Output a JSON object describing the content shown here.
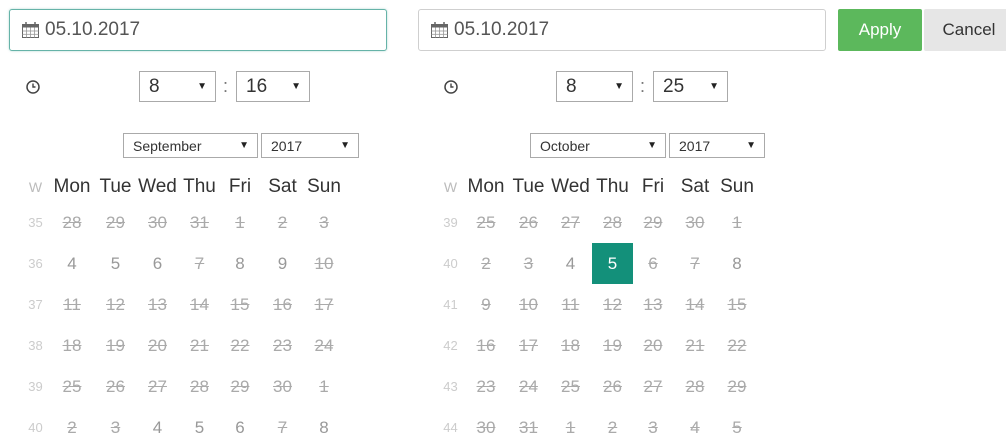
{
  "start": {
    "date": "05.10.2017",
    "hour": "8",
    "minute": "16",
    "month": "September",
    "year": "2017"
  },
  "end": {
    "date": "05.10.2017",
    "hour": "8",
    "minute": "25",
    "month": "October",
    "year": "2017"
  },
  "buttons": {
    "apply": "Apply",
    "cancel": "Cancel"
  },
  "time_separator": ":",
  "icons": {
    "date": "calendar-icon",
    "time": "clock-icon",
    "dropdown": "caret-down-icon"
  },
  "colors": {
    "apply": "#5cb85c",
    "selected_day": "#13907a",
    "active_border": "#66b3a8"
  },
  "calendar_headers": [
    "W",
    "Mon",
    "Tue",
    "Wed",
    "Thu",
    "Fri",
    "Sat",
    "Sun"
  ],
  "left_calendar": {
    "weeks": [
      {
        "week": "35",
        "days": [
          {
            "d": "28",
            "s": "dis"
          },
          {
            "d": "29",
            "s": "dis"
          },
          {
            "d": "30",
            "s": "dis"
          },
          {
            "d": "31",
            "s": "dis"
          },
          {
            "d": "1",
            "s": "dis"
          },
          {
            "d": "2",
            "s": "dis"
          },
          {
            "d": "3",
            "s": "dis"
          }
        ]
      },
      {
        "week": "36",
        "days": [
          {
            "d": "4",
            "s": "avail"
          },
          {
            "d": "5",
            "s": "avail"
          },
          {
            "d": "6",
            "s": "avail"
          },
          {
            "d": "7",
            "s": "dis"
          },
          {
            "d": "8",
            "s": "avail"
          },
          {
            "d": "9",
            "s": "avail"
          },
          {
            "d": "10",
            "s": "dis"
          }
        ]
      },
      {
        "week": "37",
        "days": [
          {
            "d": "11",
            "s": "dis"
          },
          {
            "d": "12",
            "s": "dis"
          },
          {
            "d": "13",
            "s": "dis"
          },
          {
            "d": "14",
            "s": "dis"
          },
          {
            "d": "15",
            "s": "dis"
          },
          {
            "d": "16",
            "s": "dis"
          },
          {
            "d": "17",
            "s": "dis"
          }
        ]
      },
      {
        "week": "38",
        "days": [
          {
            "d": "18",
            "s": "dis"
          },
          {
            "d": "19",
            "s": "dis"
          },
          {
            "d": "20",
            "s": "dis"
          },
          {
            "d": "21",
            "s": "dis"
          },
          {
            "d": "22",
            "s": "dis"
          },
          {
            "d": "23",
            "s": "dis"
          },
          {
            "d": "24",
            "s": "dis"
          }
        ]
      },
      {
        "week": "39",
        "days": [
          {
            "d": "25",
            "s": "dis"
          },
          {
            "d": "26",
            "s": "dis"
          },
          {
            "d": "27",
            "s": "dis"
          },
          {
            "d": "28",
            "s": "dis"
          },
          {
            "d": "29",
            "s": "dis"
          },
          {
            "d": "30",
            "s": "dis"
          },
          {
            "d": "1",
            "s": "dis"
          }
        ]
      },
      {
        "week": "40",
        "days": [
          {
            "d": "2",
            "s": "dis"
          },
          {
            "d": "3",
            "s": "dis"
          },
          {
            "d": "4",
            "s": "avail"
          },
          {
            "d": "5",
            "s": "avail"
          },
          {
            "d": "6",
            "s": "avail"
          },
          {
            "d": "7",
            "s": "dis"
          },
          {
            "d": "8",
            "s": "avail"
          }
        ]
      }
    ]
  },
  "right_calendar": {
    "weeks": [
      {
        "week": "39",
        "days": [
          {
            "d": "25",
            "s": "dis"
          },
          {
            "d": "26",
            "s": "dis"
          },
          {
            "d": "27",
            "s": "dis"
          },
          {
            "d": "28",
            "s": "dis"
          },
          {
            "d": "29",
            "s": "dis"
          },
          {
            "d": "30",
            "s": "dis"
          },
          {
            "d": "1",
            "s": "dis"
          }
        ]
      },
      {
        "week": "40",
        "days": [
          {
            "d": "2",
            "s": "dis"
          },
          {
            "d": "3",
            "s": "dis"
          },
          {
            "d": "4",
            "s": "avail"
          },
          {
            "d": "5",
            "s": "sel-day"
          },
          {
            "d": "6",
            "s": "dis"
          },
          {
            "d": "7",
            "s": "dis"
          },
          {
            "d": "8",
            "s": "avail"
          }
        ]
      },
      {
        "week": "41",
        "days": [
          {
            "d": "9",
            "s": "dis"
          },
          {
            "d": "10",
            "s": "dis"
          },
          {
            "d": "11",
            "s": "dis"
          },
          {
            "d": "12",
            "s": "dis"
          },
          {
            "d": "13",
            "s": "dis"
          },
          {
            "d": "14",
            "s": "dis"
          },
          {
            "d": "15",
            "s": "dis"
          }
        ]
      },
      {
        "week": "42",
        "days": [
          {
            "d": "16",
            "s": "dis"
          },
          {
            "d": "17",
            "s": "dis"
          },
          {
            "d": "18",
            "s": "dis"
          },
          {
            "d": "19",
            "s": "dis"
          },
          {
            "d": "20",
            "s": "dis"
          },
          {
            "d": "21",
            "s": "dis"
          },
          {
            "d": "22",
            "s": "dis"
          }
        ]
      },
      {
        "week": "43",
        "days": [
          {
            "d": "23",
            "s": "dis"
          },
          {
            "d": "24",
            "s": "dis"
          },
          {
            "d": "25",
            "s": "dis"
          },
          {
            "d": "26",
            "s": "dis"
          },
          {
            "d": "27",
            "s": "dis"
          },
          {
            "d": "28",
            "s": "dis"
          },
          {
            "d": "29",
            "s": "dis"
          }
        ]
      },
      {
        "week": "44",
        "days": [
          {
            "d": "30",
            "s": "dis"
          },
          {
            "d": "31",
            "s": "dis"
          },
          {
            "d": "1",
            "s": "dis"
          },
          {
            "d": "2",
            "s": "dis"
          },
          {
            "d": "3",
            "s": "dis"
          },
          {
            "d": "4",
            "s": "dis"
          },
          {
            "d": "5",
            "s": "dis"
          }
        ]
      }
    ]
  }
}
